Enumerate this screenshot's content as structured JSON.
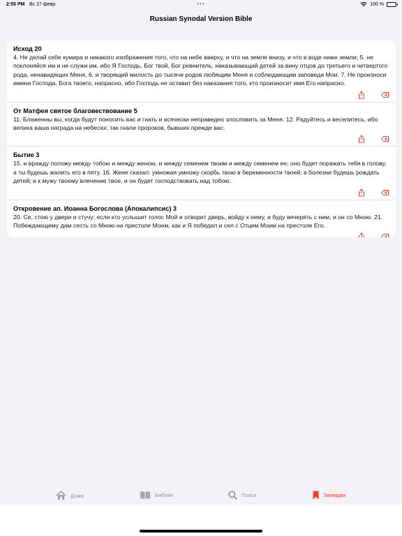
{
  "status_bar": {
    "time": "2:55 PM",
    "date": "Вс 27 февр.",
    "battery": "100 %",
    "icons": [
      "wifi-icon",
      "battery-icon"
    ]
  },
  "nav": {
    "title": "Russian Synodal Version Bible"
  },
  "bookmarks": [
    {
      "title": "Исход 20",
      "text": "4. Не делай себе кумира и никакого изображения того, что на небе вверху, и что на земле внизу, и что в воде ниже земли; 5. не поклоняйся им и не служи им, ибо Я Господь, Бог твой, Бог ревнитель, наказывающий детей за вину отцов до третьего и четвертого рода, ненавидящих Меня, 6. и творящий милость до тысячи родов любящим Меня и соблюдающим заповеди Мои. 7. Не произноси имени Господа, Бога твоего, напрасно, ибо Господь не оставит без наказания того, кто произносит имя Его напрасно."
    },
    {
      "title": "От Матфея святое благовествование 5",
      "text": "11. Блаженны вы, когда будут поносить вас и гнать и всячески неправедно злословить за Меня. 12. Радуйтесь и веселитесь, ибо велика ваша награда на небесах: так гнали пророков, бывших прежде вас."
    },
    {
      "title": "Бытие 3",
      "text": "15. и вражду положу между тобою и между женою, и между семенем твоим и между семенем ее; оно будет поражать тебя в голову, а ты будешь жалить его в пяту. 16. Жене сказал: умножая умножу скорбь твою в беременности твоей; в болезни будешь рождать детей; и к мужу твоему влечение твое, и он будет господствовать над тобою."
    },
    {
      "title": "Откровение ап. Иоанна Богослова (Апокалипсис) 3",
      "text": "20. Се, стою у двери и стучу: если кто услышит голос Мой и отворит дверь, войду к нему, и буду вечерять с ним, и он со Мною. 21. Побеждающему дам сесть со Мною на престоле Моем, как и Я победил и сел с Отцем Моим на престоле Его."
    }
  ],
  "tabs": [
    {
      "label": "Дома",
      "icon": "home-icon"
    },
    {
      "label": "Библия",
      "icon": "book-icon"
    },
    {
      "label": "Поиск",
      "icon": "search-icon"
    },
    {
      "label": "Закладки",
      "icon": "bookmark-icon"
    }
  ],
  "colors": {
    "accent": "#ff3b30",
    "inactive_tab": "#8e8e93",
    "background": "#f2f2f7",
    "card": "#ffffff"
  }
}
